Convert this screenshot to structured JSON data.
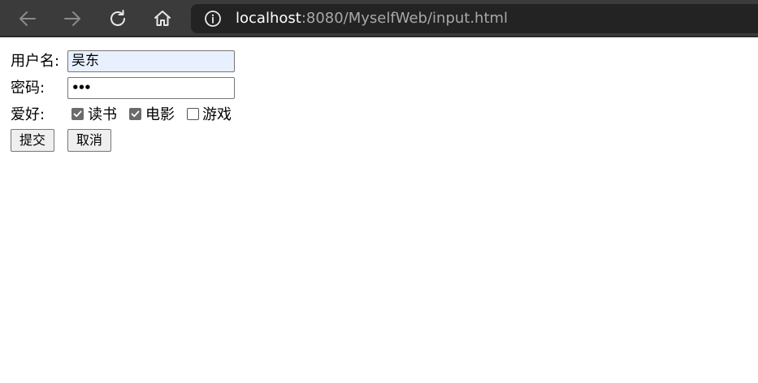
{
  "browser": {
    "url_host": "localhost",
    "url_rest": ":8080/MyselfWeb/input.html",
    "nav_icons": [
      "back-icon",
      "forward-icon",
      "refresh-icon",
      "home-icon",
      "info-icon"
    ]
  },
  "form": {
    "username": {
      "label": "用户名:",
      "value": "吴东"
    },
    "password": {
      "label": "密码:",
      "value_masked": "•••"
    },
    "hobbies": {
      "label": "爱好:",
      "options": [
        {
          "label": "读书",
          "checked": true
        },
        {
          "label": "电影",
          "checked": true
        },
        {
          "label": "游戏",
          "checked": false
        }
      ]
    },
    "submit_label": "提交",
    "cancel_label": "取消"
  }
}
